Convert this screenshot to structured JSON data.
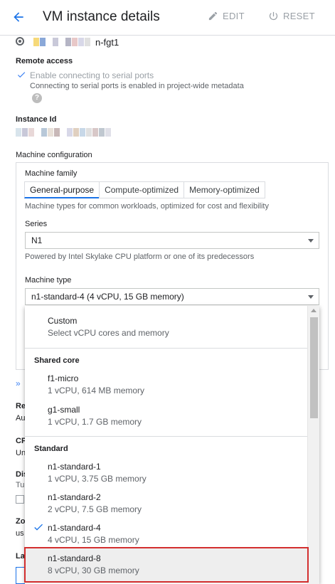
{
  "header": {
    "title": "VM instance details",
    "edit_label": "EDIT",
    "reset_label": "RESET"
  },
  "instance": {
    "name_suffix": "n-fgt1"
  },
  "remote_access": {
    "heading": "Remote access",
    "checkbox_label": "Enable connecting to serial ports",
    "note": "Connecting to serial ports is enabled in project-wide metadata"
  },
  "instance_id": {
    "heading": "Instance Id"
  },
  "machine_config": {
    "heading": "Machine configuration",
    "family_label": "Machine family",
    "tabs": [
      "General-purpose",
      "Compute-optimized",
      "Memory-optimized"
    ],
    "family_desc": "Machine types for common workloads, optimized for cost and flexibility",
    "series_label": "Series",
    "series_value": "N1",
    "series_desc": "Powered by Intel Skylake CPU platform or one of its predecessors",
    "type_label": "Machine type",
    "type_value": "n1-standard-4 (4 vCPU, 15 GB memory)"
  },
  "left_fragments": [
    "Re",
    "Au",
    "CP",
    "Un",
    "Dis",
    "Tu",
    "Zo",
    "us",
    "La"
  ],
  "menu": {
    "custom": {
      "name": "Custom",
      "desc": "Select vCPU cores and memory"
    },
    "shared_core_label": "Shared core",
    "shared": [
      {
        "name": "f1-micro",
        "desc": "1 vCPU, 614 MB memory"
      },
      {
        "name": "g1-small",
        "desc": "1 vCPU, 1.7 GB memory"
      }
    ],
    "standard_label": "Standard",
    "standard": [
      {
        "name": "n1-standard-1",
        "desc": "1 vCPU, 3.75 GB memory"
      },
      {
        "name": "n1-standard-2",
        "desc": "2 vCPU, 7.5 GB memory"
      },
      {
        "name": "n1-standard-4",
        "desc": "4 vCPU, 15 GB memory"
      },
      {
        "name": "n1-standard-8",
        "desc": "8 vCPU, 30 GB memory"
      }
    ]
  },
  "colors": {
    "accent": "#1a73e8",
    "highlight_border": "#d32f2f"
  }
}
